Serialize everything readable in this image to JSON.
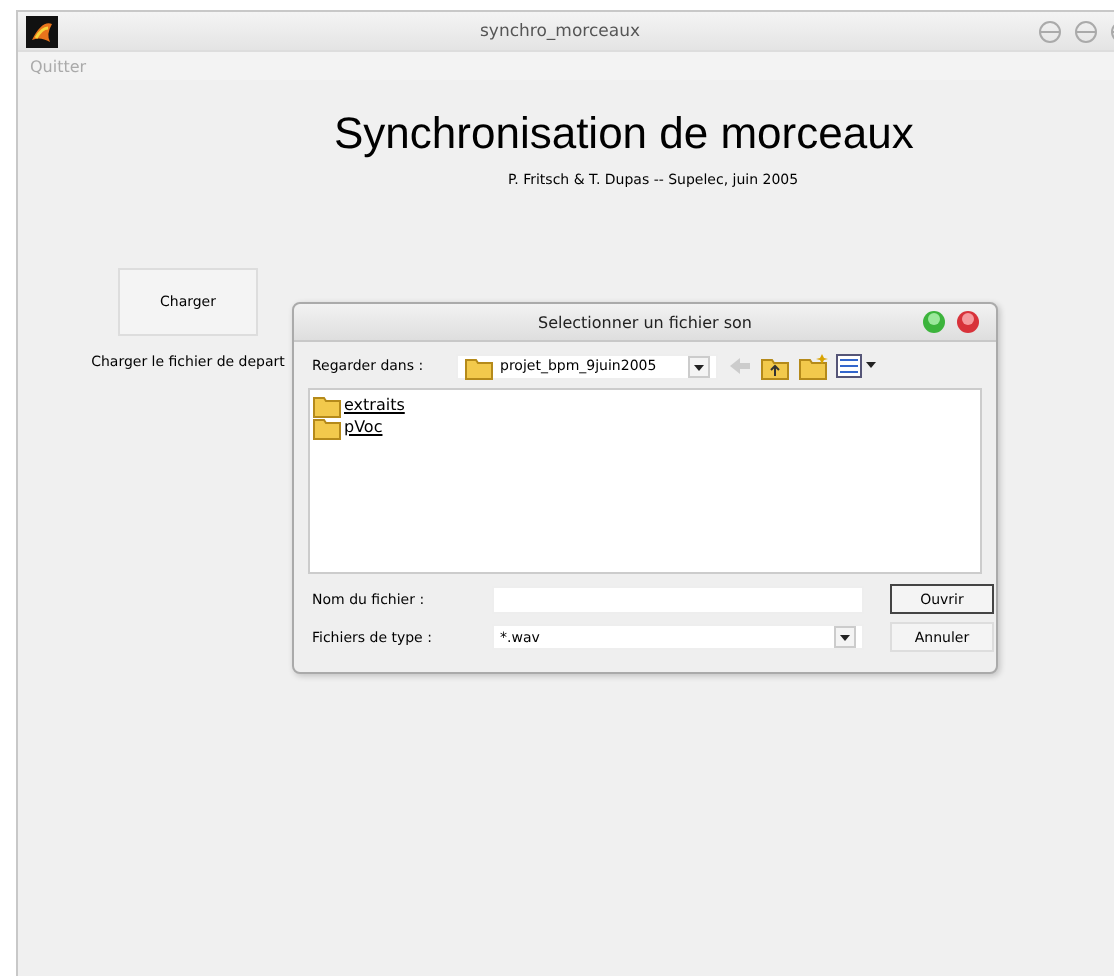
{
  "window": {
    "title": "synchro_morceaux"
  },
  "menu": [
    "Quitter"
  ],
  "heading": "Synchronisation de morceaux",
  "subtitle": "P. Fritsch & T. Dupas -- Supelec, juin 2005",
  "load_button": "Charger",
  "load_caption": "Charger le fichier de depart",
  "dialog": {
    "title": "Selectionner un fichier son",
    "look_in_label": "Regarder dans :",
    "look_in_value": "projet_bpm_9juin2005",
    "items": [
      {
        "name": "extraits",
        "selected": false
      },
      {
        "name": "pVoc",
        "selected": false
      }
    ],
    "filename_label": "Nom du fichier :",
    "filetype_label": "Fichiers de type :",
    "filetype_value": "*.wav",
    "buttons": [
      {
        "label": "Ouvrir",
        "default": true
      },
      {
        "label": "Annuler",
        "default": false
      }
    ]
  }
}
